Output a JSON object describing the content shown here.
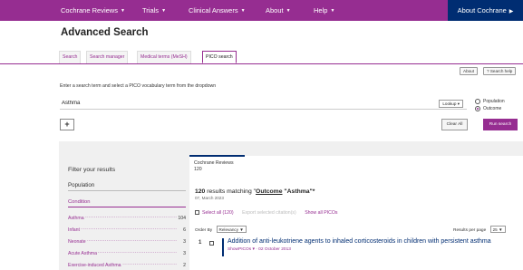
{
  "topnav": {
    "items": [
      {
        "label": "Cochrane Reviews"
      },
      {
        "label": "Trials"
      },
      {
        "label": "Clinical Answers"
      },
      {
        "label": "About"
      },
      {
        "label": "Help"
      }
    ],
    "about_cochrane": "About Cochrane",
    "bg_color": "#962d91",
    "about_bg_color": "#002d72"
  },
  "page_title": "Advanced Search",
  "tabs": [
    {
      "label": "Search",
      "active": false
    },
    {
      "label": "Search manager",
      "active": false
    },
    {
      "label": "Medical terms (MeSH)",
      "active": false
    },
    {
      "label": "PICO search",
      "active": true
    }
  ],
  "help_buttons": {
    "about": "About",
    "search_help": "? Search help"
  },
  "instructions": "Enter a search term and select a PICO vocabulary term from the dropdown",
  "search": {
    "value": "Asthma",
    "lookup_label": "Lookup",
    "radio_options": [
      {
        "label": "Population",
        "selected": false
      },
      {
        "label": "Outcome",
        "selected": true
      }
    ]
  },
  "actions": {
    "add": "+",
    "clear_all": "Clear All",
    "run_search": "Run search"
  },
  "filters": {
    "title": "Filter your results",
    "population_heading": "Population",
    "condition_heading": "Condition",
    "conditions": [
      {
        "label": "Asthma",
        "count": "104"
      },
      {
        "label": "Infant",
        "count": "6"
      },
      {
        "label": "Neonate",
        "count": "3"
      },
      {
        "label": "Acute Asthma",
        "count": "3"
      },
      {
        "label": "Exercise-induced Asthma",
        "count": "2"
      }
    ]
  },
  "results": {
    "tab_label": "Cochrane Reviews",
    "tab_count": "120",
    "count": "120",
    "matching_text": "results matching",
    "field": "Outcome",
    "term": "\"Asthma\"*",
    "date": "07, March 2023",
    "select_all": "Select all (120)",
    "export_selected": "Export selected citation(s)",
    "show_all_picos": "Show all PICOs",
    "order_by_label": "Order By",
    "order_by_value": "Relevancy",
    "per_page_label": "Results per page",
    "per_page_value": "25",
    "items": [
      {
        "number": "1",
        "title": "Addition of anti-leukotriene agents to inhaled corticosteroids in children with persistent asthma",
        "show_picos": "ShowPICOs",
        "date": "02 October 2013"
      }
    ]
  }
}
